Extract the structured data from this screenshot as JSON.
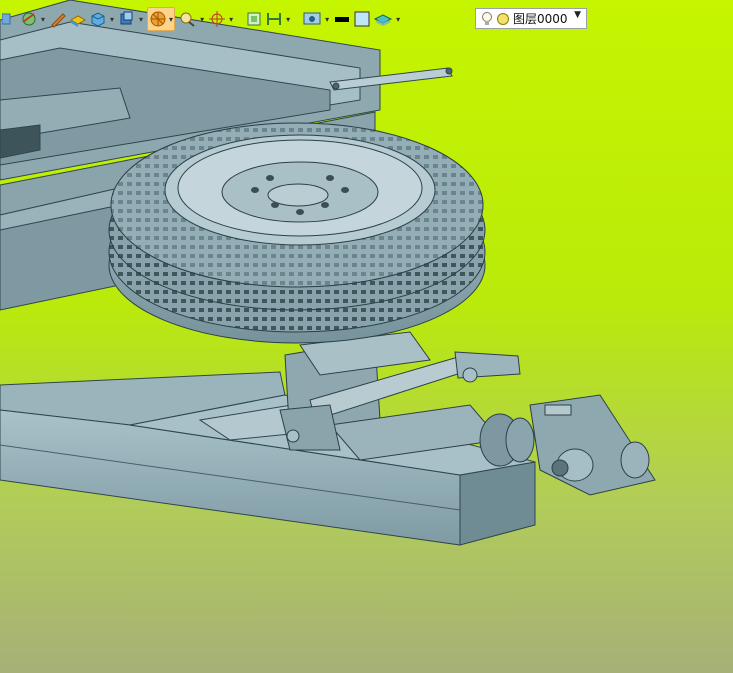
{
  "toolbar": {
    "items": [
      {
        "icon": "line-tool-icon"
      },
      {
        "icon": "curve-tool-icon"
      },
      {
        "icon": "sketch-pencil-icon"
      },
      {
        "icon": "surface-tool-icon"
      },
      {
        "icon": "solid-box-icon"
      },
      {
        "icon": "view-cube-icon"
      },
      {
        "icon": "render-sphere-icon",
        "active": true
      },
      {
        "icon": "zoom-region-icon"
      },
      {
        "icon": "snap-target-icon"
      },
      {
        "icon": "frame-view-icon"
      },
      {
        "icon": "dimension-icon"
      },
      {
        "icon": "display-settings-icon"
      },
      {
        "icon": "line-color-icon"
      },
      {
        "icon": "fill-color-icon"
      },
      {
        "icon": "layer-stack-icon"
      }
    ],
    "layer_combo": {
      "value": "图层0000"
    }
  },
  "colors": {
    "viewport_top": "#c6f500",
    "viewport_bottom": "#a6b077",
    "model_fill": "#8fa9b1",
    "model_dark": "#5d7880",
    "line_color_swatch": "#000000",
    "fill_color_swatch": "#bfe6f5"
  }
}
